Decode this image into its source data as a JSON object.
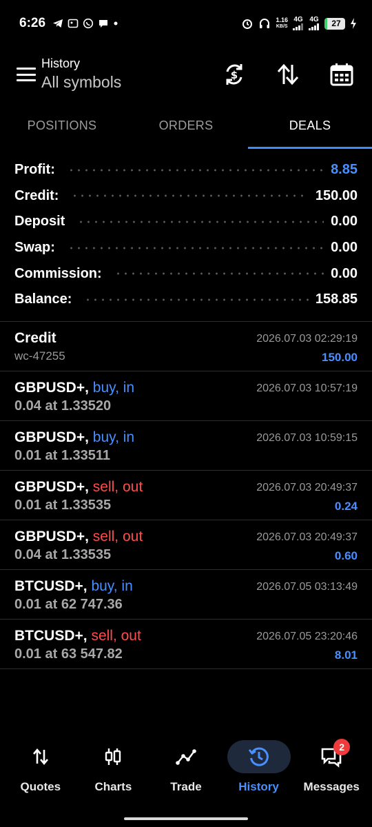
{
  "status_bar": {
    "time": "6:26",
    "network_speed_value": "1.16",
    "network_speed_unit": "KB/S",
    "network_1": "4G",
    "network_2": "4G",
    "battery": "27"
  },
  "toolbar": {
    "title": "History",
    "subtitle": "All symbols"
  },
  "tabs": [
    {
      "label": "POSITIONS",
      "active": false
    },
    {
      "label": "ORDERS",
      "active": false
    },
    {
      "label": "DEALS",
      "active": true
    }
  ],
  "summary": [
    {
      "label": "Profit:",
      "value": "8.85",
      "highlight": true
    },
    {
      "label": "Credit:",
      "value": "150.00",
      "highlight": false
    },
    {
      "label": "Deposit",
      "value": "0.00",
      "highlight": false
    },
    {
      "label": "Swap:",
      "value": "0.00",
      "highlight": false
    },
    {
      "label": "Commission:",
      "value": "0.00",
      "highlight": false
    },
    {
      "label": "Balance:",
      "value": "158.85",
      "highlight": false
    }
  ],
  "deals": [
    {
      "symbol": "Credit",
      "direction": "",
      "side": "",
      "detail": "wc-47255",
      "time": "2026.07.03 02:29:19",
      "amount": "150.00"
    },
    {
      "symbol": "GBPUSD+,",
      "direction": "buy, in",
      "side": "buy",
      "detail": "0.04 at 1.33520",
      "time": "2026.07.03 10:57:19",
      "amount": ""
    },
    {
      "symbol": "GBPUSD+,",
      "direction": "buy, in",
      "side": "buy",
      "detail": "0.01 at 1.33511",
      "time": "2026.07.03 10:59:15",
      "amount": ""
    },
    {
      "symbol": "GBPUSD+,",
      "direction": "sell, out",
      "side": "sell",
      "detail": "0.01 at 1.33535",
      "time": "2026.07.03 20:49:37",
      "amount": "0.24"
    },
    {
      "symbol": "GBPUSD+,",
      "direction": "sell, out",
      "side": "sell",
      "detail": "0.04 at 1.33535",
      "time": "2026.07.03 20:49:37",
      "amount": "0.60"
    },
    {
      "symbol": "BTCUSD+,",
      "direction": "buy, in",
      "side": "buy",
      "detail": "0.01 at 62 747.36",
      "time": "2026.07.05 03:13:49",
      "amount": ""
    },
    {
      "symbol": "BTCUSD+,",
      "direction": "sell, out",
      "side": "sell",
      "detail": "0.01 at 63 547.82",
      "time": "2026.07.05 23:20:46",
      "amount": "8.01"
    }
  ],
  "bottom_nav": [
    {
      "label": "Quotes",
      "icon": "quotes-arrows-icon",
      "active": false
    },
    {
      "label": "Charts",
      "icon": "candlestick-icon",
      "active": false
    },
    {
      "label": "Trade",
      "icon": "trend-line-icon",
      "active": false
    },
    {
      "label": "History",
      "icon": "history-clock-icon",
      "active": true
    },
    {
      "label": "Messages",
      "icon": "chat-bubble-icon",
      "active": false,
      "badge": "2"
    }
  ],
  "colors": {
    "accent": "#4a8fff",
    "sell": "#ff4c4c",
    "background": "#000000"
  }
}
